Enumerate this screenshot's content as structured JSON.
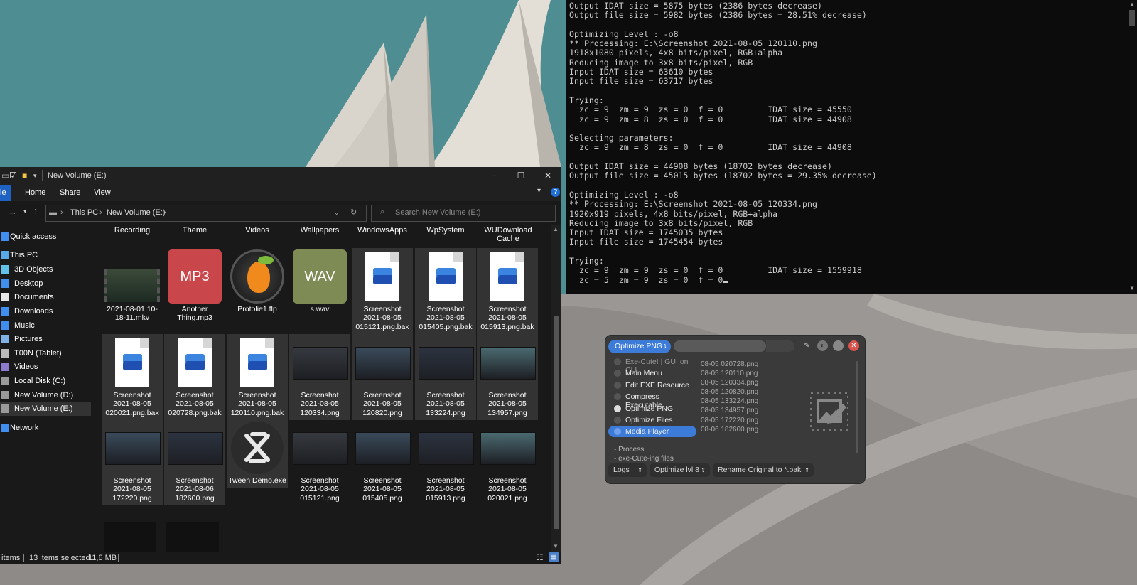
{
  "console": {
    "lines": [
      "Output IDAT size = 5875 bytes (2386 bytes decrease)",
      "Output file size = 5982 bytes (2386 bytes = 28.51% decrease)",
      "",
      "Optimizing Level : -o8",
      "** Processing: E:\\Screenshot 2021-08-05 120110.png",
      "1918x1080 pixels, 4x8 bits/pixel, RGB+alpha",
      "Reducing image to 3x8 bits/pixel, RGB",
      "Input IDAT size = 63610 bytes",
      "Input file size = 63717 bytes",
      "",
      "Trying:",
      "  zc = 9  zm = 9  zs = 0  f = 0         IDAT size = 45550",
      "  zc = 9  zm = 8  zs = 0  f = 0         IDAT size = 44908",
      "",
      "Selecting parameters:",
      "  zc = 9  zm = 8  zs = 0  f = 0         IDAT size = 44908",
      "",
      "Output IDAT size = 44908 bytes (18702 bytes decrease)",
      "Output file size = 45015 bytes (18702 bytes = 29.35% decrease)",
      "",
      "Optimizing Level : -o8",
      "** Processing: E:\\Screenshot 2021-08-05 120334.png",
      "1920x919 pixels, 4x8 bits/pixel, RGB+alpha",
      "Reducing image to 3x8 bits/pixel, RGB",
      "Input IDAT size = 1745035 bytes",
      "Input file size = 1745454 bytes",
      "",
      "Trying:",
      "  zc = 9  zm = 9  zs = 0  f = 0         IDAT size = 1559918",
      "  zc = 5  zm = 9  zs = 0  f = 0"
    ]
  },
  "explorer": {
    "title": "New Volume (E:)",
    "ribbon_tabs": [
      "Home",
      "Share",
      "View"
    ],
    "file_tab_fragment": "le",
    "breadcrumb": [
      "This PC",
      "New Volume (E:)"
    ],
    "search_placeholder": "Search New Volume (E:)",
    "nav": [
      {
        "label": "Quick access",
        "icon": "star-icon"
      },
      {
        "label": "This PC",
        "icon": "pc-icon"
      },
      {
        "label": "3D Objects",
        "icon": "cube-icon"
      },
      {
        "label": "Desktop",
        "icon": "desktop-icon"
      },
      {
        "label": "Documents",
        "icon": "documents-icon"
      },
      {
        "label": "Downloads",
        "icon": "download-icon"
      },
      {
        "label": "Music",
        "icon": "music-icon"
      },
      {
        "label": "Pictures",
        "icon": "pictures-icon"
      },
      {
        "label": "T00N (Tablet)",
        "icon": "tablet-icon"
      },
      {
        "label": "Videos",
        "icon": "videos-icon"
      },
      {
        "label": "Local Disk (C:)",
        "icon": "drive-icon"
      },
      {
        "label": "New Volume (D:)",
        "icon": "drive-icon"
      },
      {
        "label": "New Volume (E:)",
        "icon": "drive-icon"
      },
      {
        "label": "Network",
        "icon": "network-icon"
      }
    ],
    "folder_labels": [
      "Recording",
      "Theme",
      "Videos",
      "Wallpapers",
      "WindowsApps",
      "WpSystem",
      "WUDownloadCache"
    ],
    "files_row1": [
      {
        "name": "2021-08-01 10-18-11.mkv",
        "kind": "video"
      },
      {
        "name": "Another Thing.mp3",
        "kind": "mp3",
        "badge": "MP3"
      },
      {
        "name": "Protolie1.flp",
        "kind": "flp"
      },
      {
        "name": "s.wav",
        "kind": "wav",
        "badge": "WAV"
      },
      {
        "name": "Screenshot 2021-08-05 015121.png.bak",
        "kind": "doc"
      },
      {
        "name": "Screenshot 2021-08-05 015405.png.bak",
        "kind": "doc"
      },
      {
        "name": "Screenshot 2021-08-05 015913.png.bak",
        "kind": "doc"
      }
    ],
    "files_row2": [
      {
        "name": "Screenshot 2021-08-05 020021.png.bak",
        "kind": "doc"
      },
      {
        "name": "Screenshot 2021-08-05 020728.png.bak",
        "kind": "doc"
      },
      {
        "name": "Screenshot 2021-08-05 120110.png.bak",
        "kind": "doc"
      },
      {
        "name": "Screenshot 2021-08-05 120334.png",
        "kind": "shot"
      },
      {
        "name": "Screenshot 2021-08-05 120820.png",
        "kind": "shot"
      },
      {
        "name": "Screenshot 2021-08-05 133224.png",
        "kind": "shot"
      },
      {
        "name": "Screenshot 2021-08-05 134957.png",
        "kind": "shot"
      }
    ],
    "files_row3": [
      {
        "name": "Screenshot 2021-08-05 172220.png",
        "kind": "shot"
      },
      {
        "name": "Screenshot 2021-08-06 182600.png",
        "kind": "shot"
      },
      {
        "name": "Tween Demo.exe",
        "kind": "exe"
      },
      {
        "name": "Screenshot 2021-08-05 015121.png",
        "kind": "shot"
      },
      {
        "name": "Screenshot 2021-08-05 015405.png",
        "kind": "shot"
      },
      {
        "name": "Screenshot 2021-08-05 015913.png",
        "kind": "shot"
      },
      {
        "name": "Screenshot 2021-08-05 020021.png",
        "kind": "shot"
      }
    ],
    "status": {
      "items": "items",
      "selected": "13 items selected",
      "size": "11,6 MB"
    }
  },
  "execute": {
    "mode": "Optimize PNG",
    "menu": [
      {
        "label": "Exe-Cute! | GUI on CLI",
        "state": "dim"
      },
      {
        "label": "Main Menu",
        "state": ""
      },
      {
        "label": "Edit EXE Resource",
        "state": ""
      },
      {
        "label": "Compress Executable",
        "state": ""
      },
      {
        "label": "Optimize PNG",
        "state": "on"
      },
      {
        "label": "Optimize Files",
        "state": ""
      },
      {
        "label": "Media Player",
        "state": "hl"
      }
    ],
    "files": [
      "08-05 020728.png",
      "08-05 120110.png",
      "08-05 120334.png",
      "08-05 120820.png",
      "08-05 133224.png",
      "08-05 134957.png",
      "08-05 172220.png",
      "08-06 182600.png"
    ],
    "log_lines": [
      "- Process",
      "- exe-Cute-ing files"
    ],
    "dropdowns": {
      "logs": "Logs",
      "level": "Optimize lvl 8",
      "rename": "Rename Original to *.bak"
    }
  }
}
